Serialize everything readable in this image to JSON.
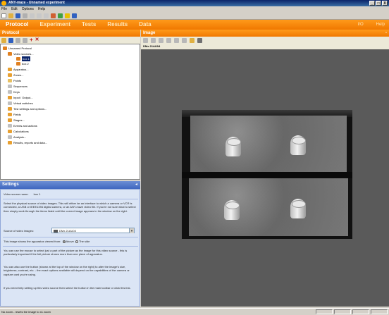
{
  "window": {
    "title": "ANY-maze - Unnamed experiment",
    "buttons": [
      "_",
      "□",
      "X"
    ]
  },
  "menu": [
    "File",
    "Edit",
    "Options",
    "Help"
  ],
  "tabs": [
    "Protocol",
    "Experiment",
    "Tests",
    "Results",
    "Data"
  ],
  "tabs_right": [
    "I/O",
    "Help"
  ],
  "protocol_panel": {
    "title": "Protocol"
  },
  "image_panel": {
    "title": "Image",
    "source_label": "DMx 21AU04"
  },
  "tree": {
    "root": "Unnamed Protocol",
    "video_sources": "Video sources...",
    "box1": "box 1",
    "box2": "box 2",
    "items": [
      "Apparatus...",
      "Zones...",
      "Points",
      "Sequences",
      "Keys",
      "Input / Output...",
      "Virtual switches",
      "Test settings and options...",
      "Fields",
      "Stages...",
      "Events and actions",
      "Calculations",
      "Analysis...",
      "Results, reports and data..."
    ]
  },
  "settings": {
    "title": "Settings",
    "name_label": "Video source name:",
    "name_value": "box 1",
    "para1": "Select the physical source of video images. This will either be an interface to which a camera or VCR is connected, a USB or IEEE1394 digital camera, or an ANY-maze video file. If you're not sure what to select then simply work through the items listed until the correct image appears in the window on the right.",
    "source_label": "Source of video images:",
    "source_value": "DMx 21AU04",
    "view_label": "This image shows the apparatus viewed from:",
    "view_above": "Above",
    "view_side": "The side",
    "para2": "You can use the mouse to select just a part of the picture as the image for this video source - this is particularly important if the full picture shows more than one piece of apparatus.",
    "para3": "You can also use the button (shown at the top of the window on the right) to alter the image's size, brightness, contrast, etc. - the exact options available will depend on the capabilities of the camera or capture card you're using.",
    "para4": "If you need help setting up this video source then select the button in the main toolbar or click this link."
  },
  "status": {
    "text": "No zoom - resets the image to x1 zoom"
  },
  "colors": {
    "accent": "#f07800",
    "settings_header": "#3f67c0",
    "settings_bg": "#dbe5f5"
  }
}
